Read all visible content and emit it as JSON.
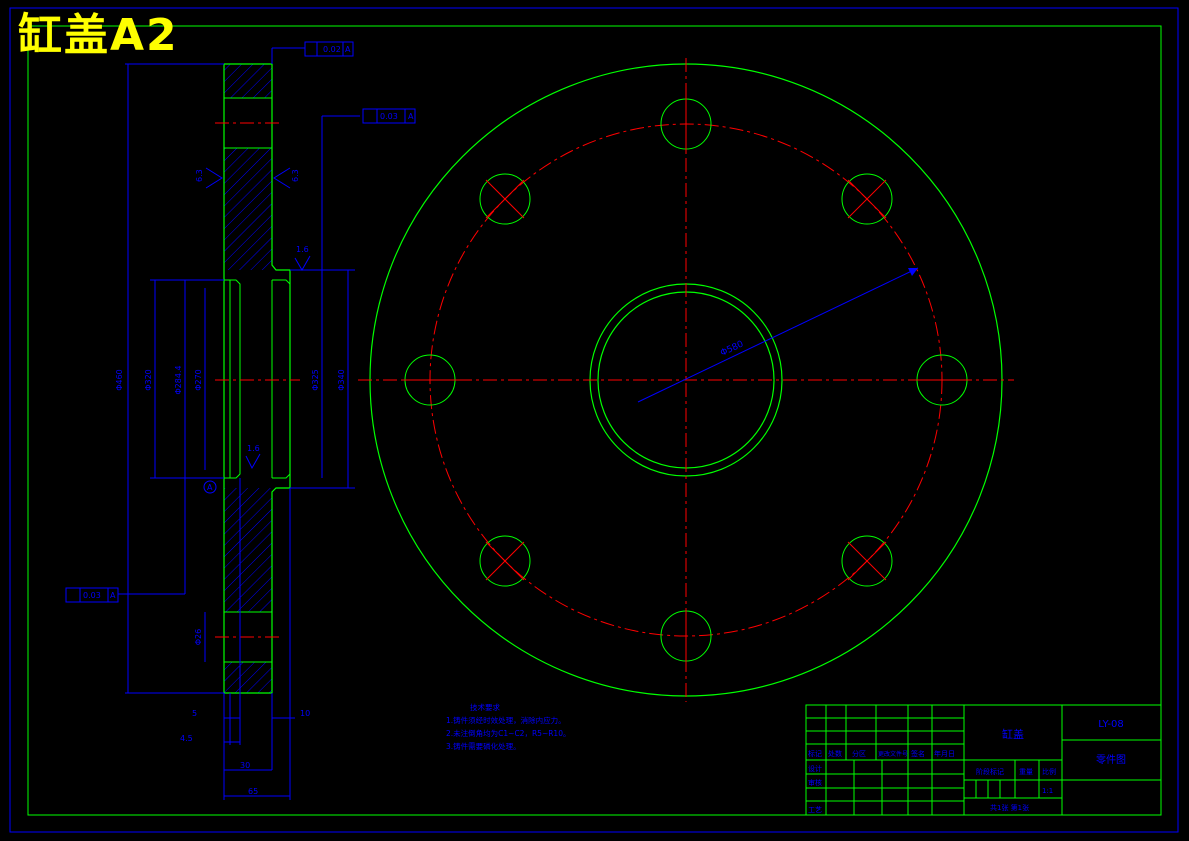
{
  "sheet_title": "缸盖A2",
  "colors": {
    "outline": "#00ff00",
    "dimension": "#0000ff",
    "centerline": "#ff0000",
    "title": "#ffff00",
    "background": "#000000"
  },
  "dimensions": {
    "bolt_circle": "Φ580",
    "overall_height": "Φ460",
    "bore1": "Φ320",
    "bore2": "Φ284.4",
    "bore3": "Φ270",
    "boss1": "Φ325",
    "boss2": "Φ340",
    "flatness": "0.02",
    "runout_top": "0.03",
    "runout_left": "0.03",
    "hole_dim": "Φ26",
    "t1": "5",
    "t2": "4.5",
    "t3": "10",
    "t4": "30",
    "t5": "65",
    "roughness_a": "6.3",
    "roughness_b": "6.3",
    "roughness_c": "1.6",
    "roughness_d": "1.6",
    "datum": "A",
    "datum_ref": "A"
  },
  "notes": {
    "heading": "技术要求",
    "line1": "1.铸件须经时效处理，消除内应力。",
    "line2": "2.未注倒角均为C1~C2，R5~R10。",
    "line3": "3.铸件需要磷化处理。"
  },
  "title_block": {
    "part_name": "缸盖",
    "drawing_no": "LY-08",
    "drawing_type": "零件图",
    "row_labels": [
      "标记",
      "处数",
      "分区",
      "更改文件号",
      "签名",
      "年月日"
    ],
    "left_labels": [
      "设计",
      "审核",
      "工艺"
    ],
    "stage_label": "阶段标记",
    "weight_label": "重量",
    "scale_label": "比例",
    "scale_value": "1:1",
    "sheets": "共1张 第1张"
  }
}
